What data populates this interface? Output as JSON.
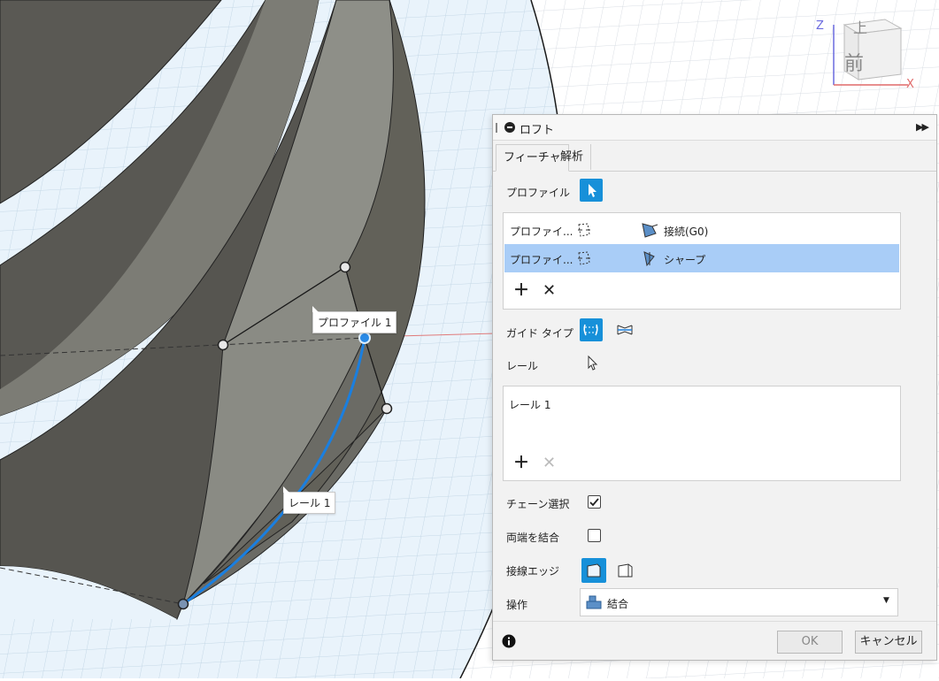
{
  "viewport": {
    "callout_profile": "プロファイル 1",
    "callout_rail": "レール 1",
    "viewcube": {
      "face_top": "上",
      "face_front": "前",
      "axis_z": "Z",
      "axis_x": "X"
    }
  },
  "panel": {
    "title": "ロフト",
    "tabs": [
      {
        "label": "フィーチャ"
      },
      {
        "label": "解析"
      }
    ],
    "profile_label": "プロファイル",
    "profiles": [
      {
        "name": "プロファイ...",
        "condition": "接続(G0)"
      },
      {
        "name": "プロファイ...",
        "condition": "シャープ"
      }
    ],
    "guide_type_label": "ガイド タイプ",
    "rail_label": "レール",
    "rails": [
      {
        "name": "レール 1"
      }
    ],
    "chain_select_label": "チェーン選択",
    "chain_select_checked": true,
    "close_ends_label": "両端を結合",
    "close_ends_checked": false,
    "tangent_edges_label": "接線エッジ",
    "operation_label": "操作",
    "operation_value": "結合",
    "buttons": {
      "ok": "OK",
      "cancel": "キャンセル"
    },
    "icons": {
      "pointer": "pointer-icon",
      "profile_type": "profile-type-icon",
      "connected": "connected-g0-icon",
      "sharp": "sharp-icon",
      "rail_guide": "rail-guide-icon",
      "centerline_guide": "centerline-guide-icon",
      "add": "plus-icon",
      "remove": "close-icon",
      "info": "info-icon",
      "dropdown": "chevron-down-icon"
    },
    "colors": {
      "selected_blue": "#1790d9",
      "row_highlight": "#a9cdf7",
      "rail_curve": "#1a7fe0"
    }
  }
}
